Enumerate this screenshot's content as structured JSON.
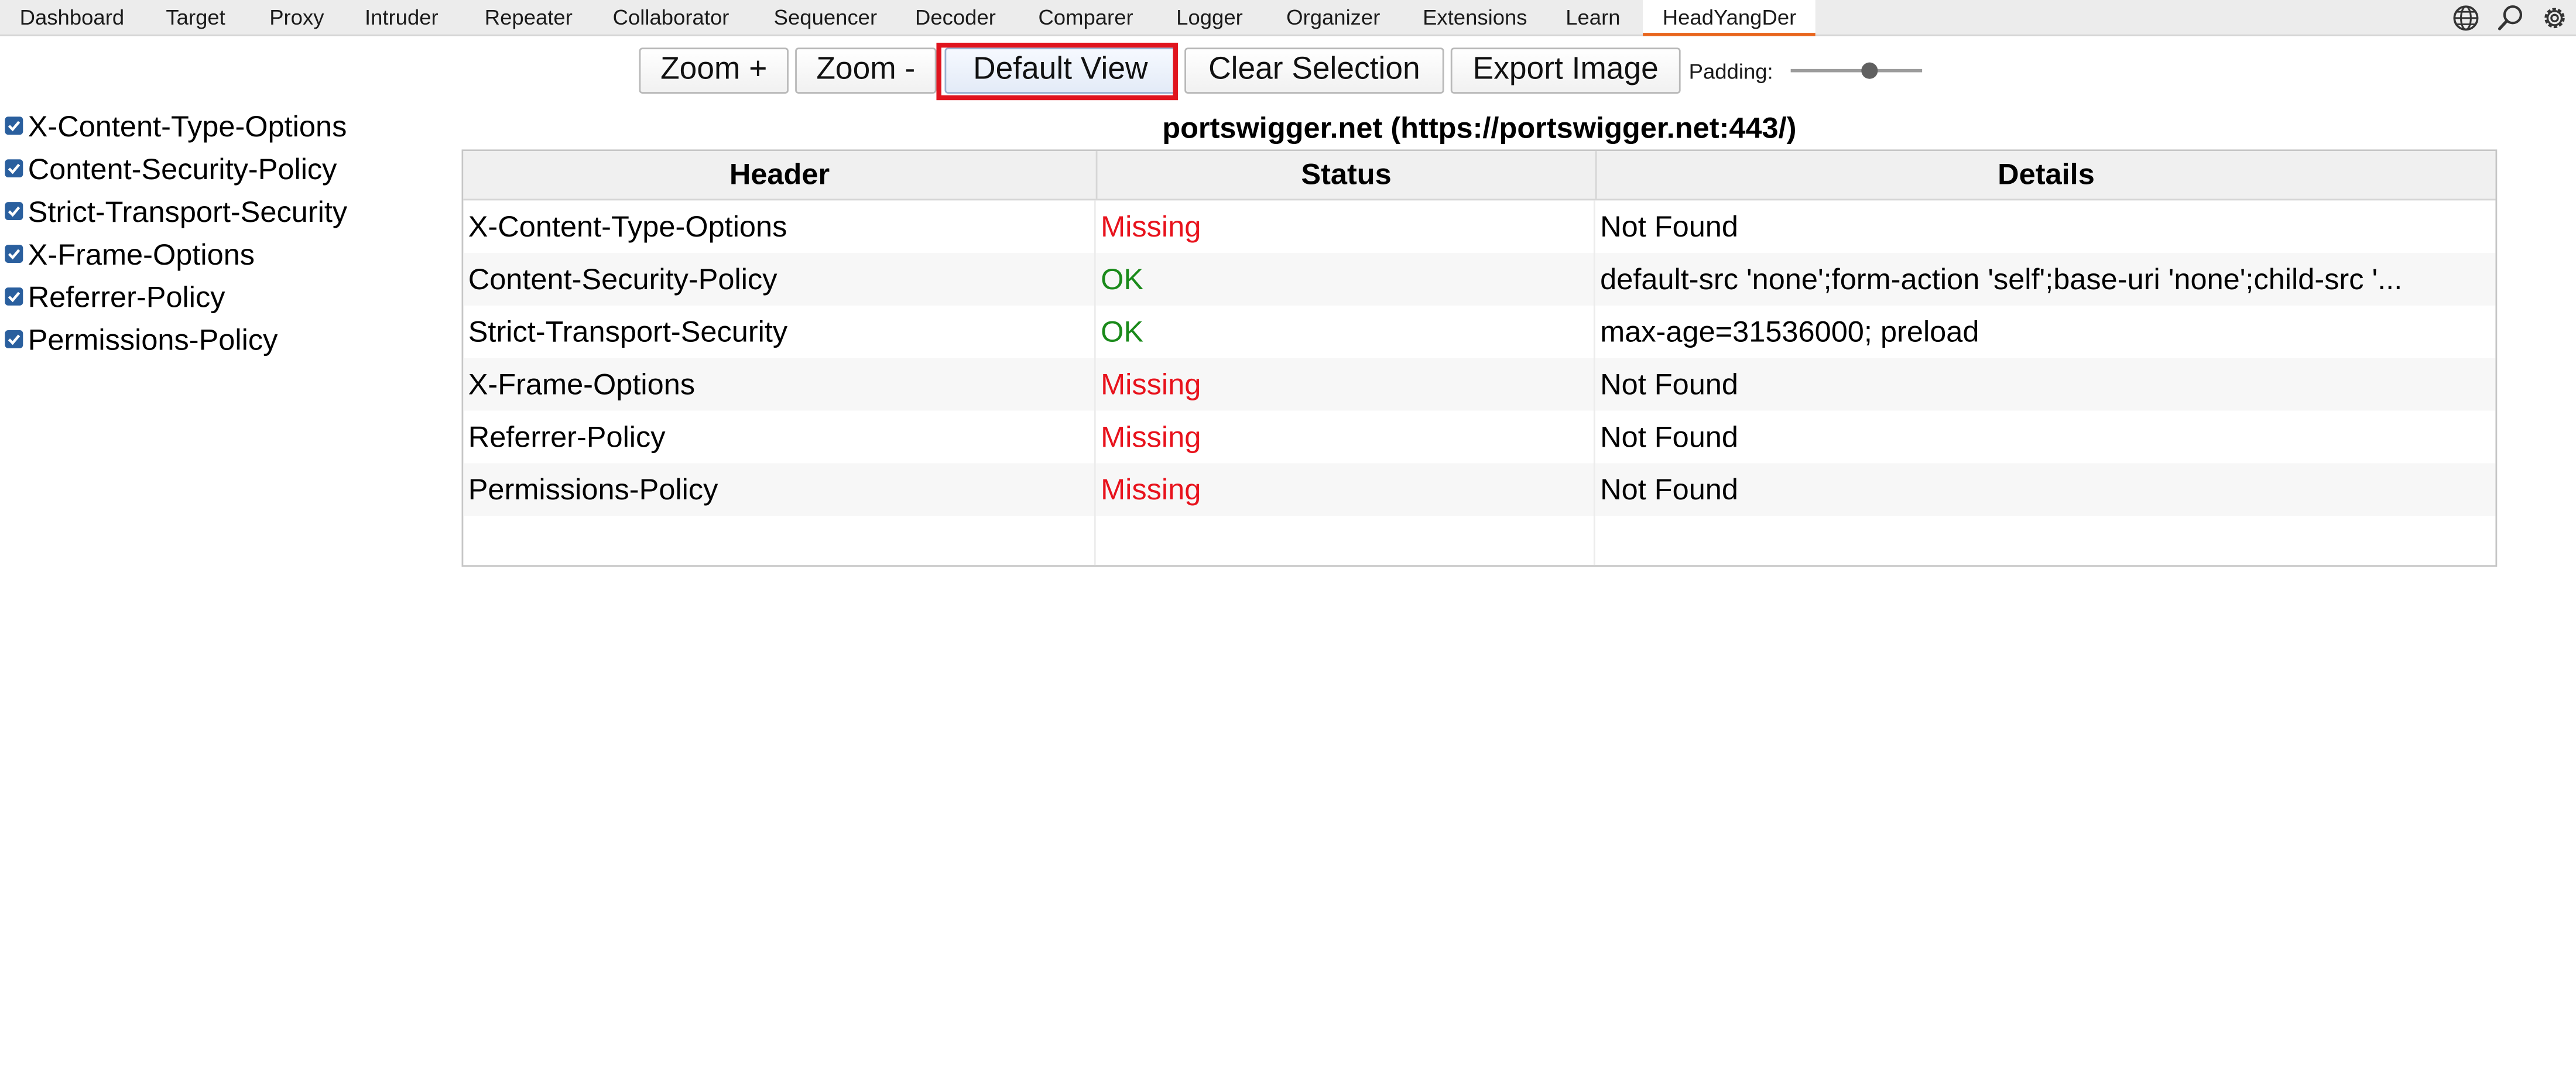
{
  "tabs": [
    {
      "label": "Dashboard"
    },
    {
      "label": "Target"
    },
    {
      "label": "Proxy"
    },
    {
      "label": "Intruder"
    },
    {
      "label": "Repeater"
    },
    {
      "label": "Collaborator"
    },
    {
      "label": "Sequencer"
    },
    {
      "label": "Decoder"
    },
    {
      "label": "Comparer"
    },
    {
      "label": "Logger"
    },
    {
      "label": "Organizer"
    },
    {
      "label": "Extensions"
    },
    {
      "label": "Learn"
    },
    {
      "label": "HeadYangDer"
    }
  ],
  "active_tab": "HeadYangDer",
  "tab_icons": [
    "globe-icon",
    "search-icon",
    "gear-icon"
  ],
  "toolbar": {
    "zoom_in": "Zoom +",
    "zoom_out": "Zoom -",
    "default_view": "Default View",
    "clear_selection": "Clear Selection",
    "export_image": "Export Image",
    "padding_label": "Padding:",
    "padding_level": 0.6
  },
  "filters": [
    {
      "label": "X-Content-Type-Options",
      "checked": true
    },
    {
      "label": "Content-Security-Policy",
      "checked": true
    },
    {
      "label": "Strict-Transport-Security",
      "checked": true
    },
    {
      "label": "X-Frame-Options",
      "checked": true
    },
    {
      "label": "Referrer-Policy",
      "checked": true
    },
    {
      "label": "Permissions-Policy",
      "checked": true
    }
  ],
  "site_title": "portswigger.net (https://portswigger.net:443/)",
  "table": {
    "columns": [
      "Header",
      "Status",
      "Details"
    ],
    "rows": [
      {
        "header": "X-Content-Type-Options",
        "status": "Missing",
        "details": "Not Found"
      },
      {
        "header": "Content-Security-Policy",
        "status": "OK",
        "details": "default-src 'none';form-action 'self';base-uri 'none';child-src '..."
      },
      {
        "header": "Strict-Transport-Security",
        "status": "OK",
        "details": "max-age=31536000; preload"
      },
      {
        "header": "X-Frame-Options",
        "status": "Missing",
        "details": "Not Found"
      },
      {
        "header": "Referrer-Policy",
        "status": "Missing",
        "details": "Not Found"
      },
      {
        "header": "Permissions-Policy",
        "status": "Missing",
        "details": "Not Found"
      }
    ]
  },
  "colors": {
    "missing": "#e8121c",
    "ok": "#1a8a1a",
    "highlight": "#e0141e",
    "active_tab_underline": "#e8651c"
  }
}
